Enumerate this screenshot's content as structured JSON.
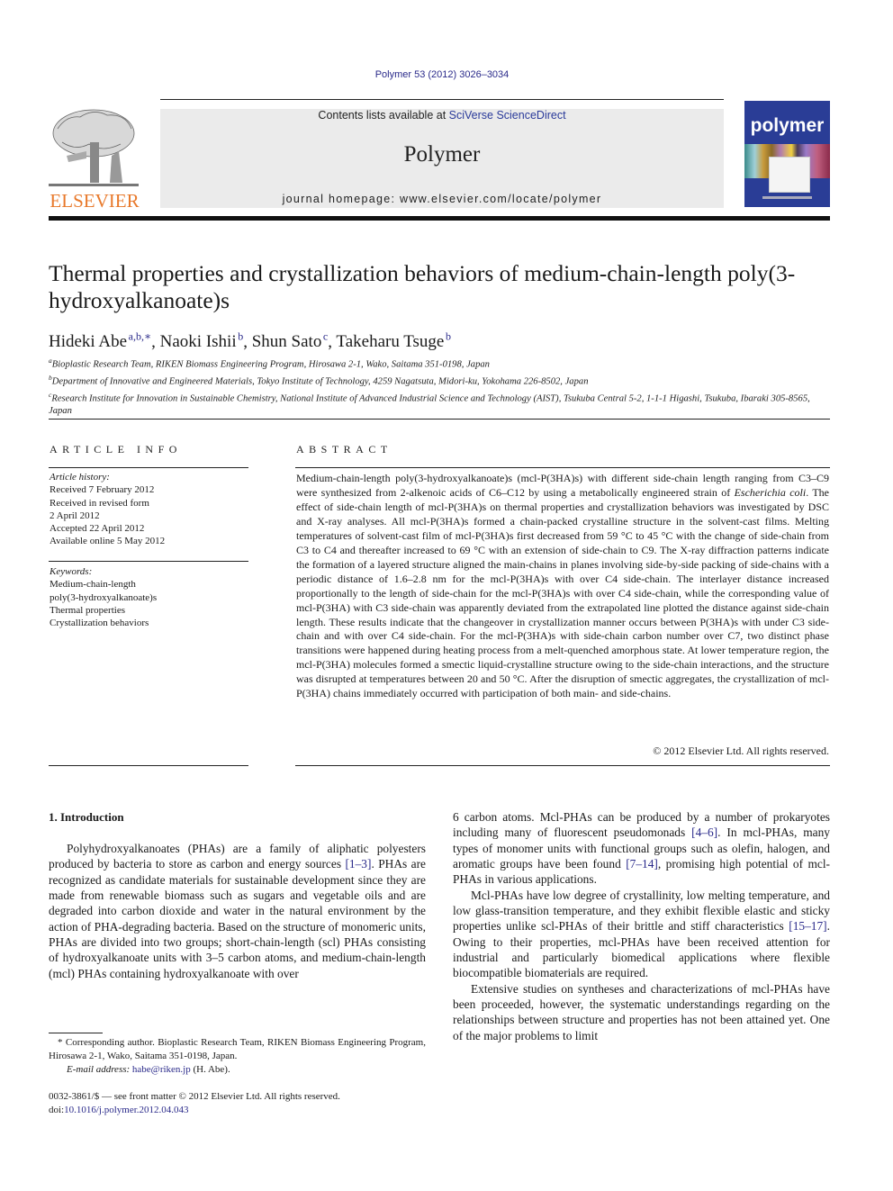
{
  "citation": "Polymer 53 (2012) 3026–3034",
  "header": {
    "publisher_logo_text": "ELSEVIER",
    "contents_prefix": "Contents lists available at ",
    "contents_link": "SciVerse ScienceDirect",
    "journal_name": "Polymer",
    "homepage": "journal homepage: www.elsevier.com/locate/polymer",
    "cover_title": "polymer",
    "colors": {
      "elsevier_orange": "#e8792b",
      "link_blue": "#2a2a8a",
      "cover_blue": "#2a3d96",
      "band_gray": "#ebebeb"
    }
  },
  "article": {
    "title": "Thermal properties and crystallization behaviors of medium-chain-length poly(3-hydroxyalkanoate)s",
    "authors": [
      {
        "name": "Hideki Abe",
        "sup": "a,b,∗",
        "sep": ", "
      },
      {
        "name": "Naoki Ishii",
        "sup": "b",
        "sep": ", "
      },
      {
        "name": "Shun Sato",
        "sup": "c",
        "sep": ", "
      },
      {
        "name": "Takeharu Tsuge",
        "sup": "b",
        "sep": ""
      }
    ],
    "affiliations": [
      {
        "mark": "a",
        "text": "Bioplastic Research Team, RIKEN Biomass Engineering Program, Hirosawa 2-1, Wako, Saitama 351-0198, Japan"
      },
      {
        "mark": "b",
        "text": "Department of Innovative and Engineered Materials, Tokyo Institute of Technology, 4259 Nagatsuta, Midori-ku, Yokohama 226-8502, Japan"
      },
      {
        "mark": "c",
        "text": "Research Institute for Innovation in Sustainable Chemistry, National Institute of Advanced Industrial Science and Technology (AIST), Tsukuba Central 5-2, 1-1-1 Higashi, Tsukuba, Ibaraki 305-8565, Japan"
      }
    ]
  },
  "article_info": {
    "heading": "ARTICLE INFO",
    "history_label": "Article history:",
    "history": [
      "Received 7 February 2012",
      "Received in revised form",
      "2 April 2012",
      "Accepted 22 April 2012",
      "Available online 5 May 2012"
    ],
    "keywords_label": "Keywords:",
    "keywords": [
      "Medium-chain-length",
      "poly(3-hydroxyalkanoate)s",
      "Thermal properties",
      "Crystallization behaviors"
    ]
  },
  "abstract": {
    "heading": "ABSTRACT",
    "text_before_italic": "Medium-chain-length poly(3-hydroxyalkanoate)s (mcl-P(3HA)s) with different side-chain length ranging from C3–C9 were synthesized from 2-alkenoic acids of C6–C12 by using a metabolically engineered strain of ",
    "italic": "Escherichia coli",
    "text_after_italic": ". The effect of side-chain length of mcl-P(3HA)s on thermal properties and crystallization behaviors was investigated by DSC and X-ray analyses. All mcl-P(3HA)s formed a chain-packed crystalline structure in the solvent-cast films. Melting temperatures of solvent-cast film of mcl-P(3HA)s first decreased from 59 °C to 45 °C with the change of side-chain from C3 to C4 and thereafter increased to 69 °C with an extension of side-chain to C9. The X-ray diffraction patterns indicate the formation of a layered structure aligned the main-chains in planes involving side-by-side packing of side-chains with a periodic distance of 1.6–2.8 nm for the mcl-P(3HA)s with over C4 side-chain. The interlayer distance increased proportionally to the length of side-chain for the mcl-P(3HA)s with over C4 side-chain, while the corresponding value of mcl-P(3HA) with C3 side-chain was apparently deviated from the extrapolated line plotted the distance against side-chain length. These results indicate that the changeover in crystallization manner occurs between P(3HA)s with under C3 side-chain and with over C4 side-chain. For the mcl-P(3HA)s with side-chain carbon number over C7, two distinct phase transitions were happened during heating process from a melt-quenched amorphous state. At lower temperature region, the mcl-P(3HA) molecules formed a smectic liquid-crystalline structure owing to the side-chain interactions, and the structure was disrupted at temperatures between 20 and 50 °C. After the disruption of smectic aggregates, the crystallization of mcl-P(3HA) chains immediately occurred with participation of both main- and side-chains.",
    "copyright": "© 2012 Elsevier Ltd. All rights reserved."
  },
  "body": {
    "section_heading": "1.  Introduction",
    "col1": {
      "p1_a": "Polyhydroxyalkanoates (PHAs) are a family of aliphatic polyesters produced by bacteria to store as carbon and energy sources ",
      "ref1": "[1–3]",
      "p1_b": ". PHAs are recognized as candidate materials for sustainable development since they are made from renewable biomass such as sugars and vegetable oils and are degraded into carbon dioxide and water in the natural environment by the action of PHA-degrading bacteria. Based on the structure of monomeric units, PHAs are divided into two groups; short-chain-length (scl) PHAs consisting of hydroxyalkanoate units with 3–5 carbon atoms, and medium-chain-length (mcl) PHAs containing hydroxyalkanoate with over"
    },
    "col2": {
      "p1_a": "6 carbon atoms. Mcl-PHAs can be produced by a number of prokaryotes including many of fluorescent pseudomonads ",
      "ref1": "[4–6]",
      "p1_b": ". In mcl-PHAs, many types of monomer units with functional groups such as olefin, halogen, and aromatic groups have been found ",
      "ref2": "[7–14]",
      "p1_c": ", promising high potential of mcl-PHAs in various applications.",
      "p2_a": "Mcl-PHAs have low degree of crystallinity, low melting temperature, and low glass-transition temperature, and they exhibit flexible elastic and sticky properties unlike scl-PHAs of their brittle and stiff characteristics ",
      "ref3": "[15–17]",
      "p2_b": ". Owing to their properties, mcl-PHAs have been received attention for industrial and particularly biomedical applications where flexible biocompatible biomaterials are required.",
      "p3": "Extensive studies on syntheses and characterizations of mcl-PHAs have been proceeded, however, the systematic understandings regarding on the relationships between structure and properties has not been attained yet. One of the major problems to limit"
    }
  },
  "footnotes": {
    "corresponding": "* Corresponding author. Bioplastic Research Team, RIKEN Biomass Engineering Program, Hirosawa 2-1, Wako, Saitama 351-0198, Japan.",
    "email_label": "E-mail address: ",
    "email": "habe@riken.jp",
    "email_suffix": " (H. Abe).",
    "issn_line": "0032-3861/$ — see front matter © 2012 Elsevier Ltd. All rights reserved.",
    "doi_prefix": "doi:",
    "doi": "10.1016/j.polymer.2012.04.043"
  }
}
